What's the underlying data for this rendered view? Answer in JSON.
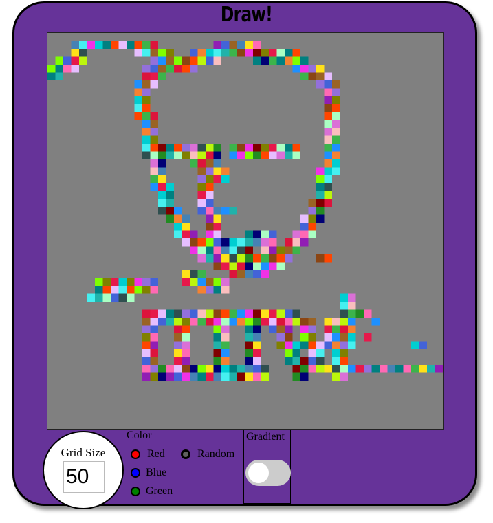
{
  "app": {
    "title": "Draw!"
  },
  "canvas": {
    "background": "#808080",
    "grid_size": 50
  },
  "controls": {
    "grid_size": {
      "label": "Grid Size",
      "value": "50"
    },
    "color": {
      "label": "Color",
      "options": [
        {
          "label": "Red",
          "swatch": "#ff0000"
        },
        {
          "label": "Blue",
          "swatch": "#0000ff"
        },
        {
          "label": "Green",
          "swatch": "#008000"
        },
        {
          "label": "Random",
          "swatch": "#606060"
        }
      ],
      "selected": "Random"
    },
    "gradient": {
      "label": "Gradient",
      "enabled": false
    }
  },
  "colors": {
    "frame": "#663399",
    "palette": [
      "#e6194b",
      "#3cb44b",
      "#4363d8",
      "#f58231",
      "#911eb4",
      "#46f0f0",
      "#f032e6",
      "#bcf60c",
      "#008080",
      "#9a6324",
      "#800000",
      "#808000",
      "#000075",
      "#aaffc3",
      "#ffe119",
      "#fabebe",
      "#e6beff",
      "#1e90ff",
      "#ff69b4",
      "#00ced1",
      "#8b4513",
      "#2f4f4f",
      "#7fff00",
      "#dc143c",
      "#20b2aa",
      "#9370db",
      "#228b22",
      "#ff4500",
      "#4682b4",
      "#da70d6"
    ]
  }
}
